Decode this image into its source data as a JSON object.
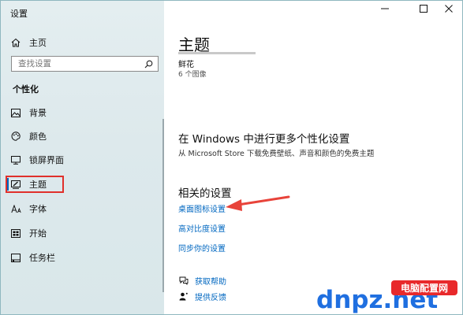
{
  "window": {
    "title": "设置"
  },
  "sidebar": {
    "home_label": "主页",
    "search_placeholder": "查找设置",
    "section_title": "个性化",
    "items": [
      {
        "label": "背景",
        "icon": "picture-icon"
      },
      {
        "label": "颜色",
        "icon": "palette-icon"
      },
      {
        "label": "锁屏界面",
        "icon": "monitor-icon"
      },
      {
        "label": "主题",
        "icon": "brush-icon"
      },
      {
        "label": "字体",
        "icon": "font-icon"
      },
      {
        "label": "开始",
        "icon": "start-grid-icon"
      },
      {
        "label": "任务栏",
        "icon": "taskbar-icon"
      }
    ]
  },
  "main": {
    "title": "主题",
    "current_theme": {
      "name": "鲜花",
      "count": "6 个图像"
    },
    "more": {
      "title": "在 Windows 中进行更多个性化设置",
      "desc": "从 Microsoft Store 下载免费壁纸、声音和颜色的免费主题"
    },
    "related": {
      "title": "相关的设置",
      "links": [
        "桌面图标设置",
        "高对比度设置",
        "同步你的设置"
      ]
    },
    "help": {
      "get_help": "获取帮助",
      "feedback": "提供反馈"
    }
  },
  "watermark": {
    "domain": "dnpz.net",
    "site_name": "电脑配置网"
  },
  "colors": {
    "accent": "#0067c0",
    "highlight": "#e0302b",
    "arrow": "#e8433a"
  }
}
